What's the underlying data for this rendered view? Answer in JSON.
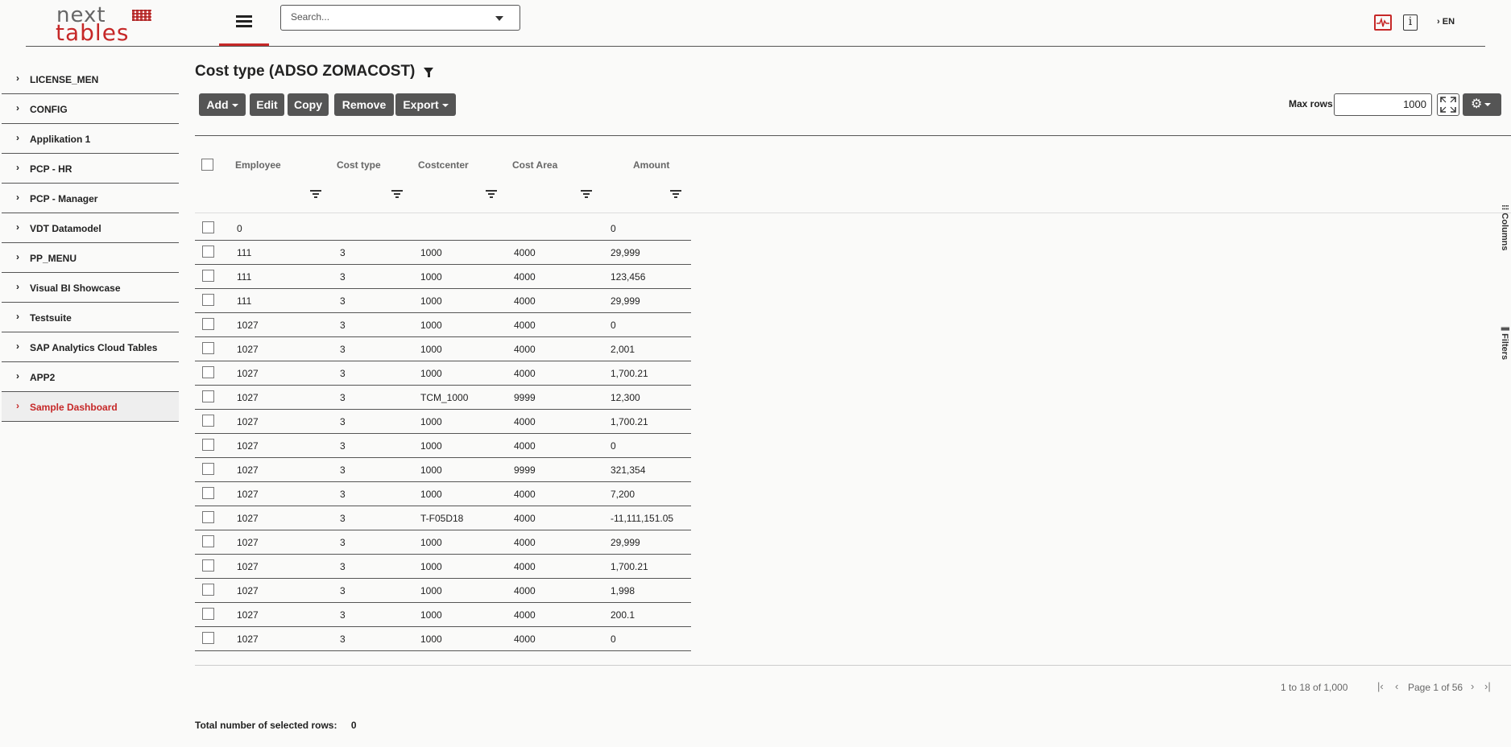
{
  "header": {
    "logo_top": "next",
    "logo_bottom": "tables",
    "search_placeholder": "Search...",
    "language": "EN",
    "info_icon_glyph": "i"
  },
  "sidebar": {
    "items": [
      {
        "label": "LICENSE_MEN"
      },
      {
        "label": "CONFIG"
      },
      {
        "label": "Applikation 1"
      },
      {
        "label": "PCP - HR"
      },
      {
        "label": "PCP - Manager"
      },
      {
        "label": "VDT Datamodel"
      },
      {
        "label": "PP_MENU"
      },
      {
        "label": "Visual BI Showcase"
      },
      {
        "label": "Testsuite"
      },
      {
        "label": "SAP Analytics Cloud Tables"
      },
      {
        "label": "APP2"
      },
      {
        "label": "Sample Dashboard",
        "active": true
      }
    ]
  },
  "main": {
    "title": "Cost type (ADSO ZOMACOST)",
    "toolbar": {
      "add": "Add",
      "edit": "Edit",
      "copy": "Copy",
      "remove": "Remove",
      "export": "Export"
    },
    "max_rows_label": "Max rows",
    "max_rows_value": "1000"
  },
  "grid": {
    "columns": [
      "Employee",
      "Cost type",
      "Costcenter",
      "Cost Area",
      "Amount"
    ],
    "rows": [
      [
        "0",
        "",
        "",
        "",
        "0"
      ],
      [
        "111",
        "3",
        "1000",
        "4000",
        "29,999"
      ],
      [
        "111",
        "3",
        "1000",
        "4000",
        "123,456"
      ],
      [
        "111",
        "3",
        "1000",
        "4000",
        "29,999"
      ],
      [
        "1027",
        "3",
        "1000",
        "4000",
        "0"
      ],
      [
        "1027",
        "3",
        "1000",
        "4000",
        "2,001"
      ],
      [
        "1027",
        "3",
        "1000",
        "4000",
        "1,700.21"
      ],
      [
        "1027",
        "3",
        "TCM_1000",
        "9999",
        "12,300"
      ],
      [
        "1027",
        "3",
        "1000",
        "4000",
        "1,700.21"
      ],
      [
        "1027",
        "3",
        "1000",
        "4000",
        "0"
      ],
      [
        "1027",
        "3",
        "1000",
        "9999",
        "321,354"
      ],
      [
        "1027",
        "3",
        "1000",
        "4000",
        "7,200"
      ],
      [
        "1027",
        "3",
        "T-F05D18",
        "4000",
        "-11,111,151.05"
      ],
      [
        "1027",
        "3",
        "1000",
        "4000",
        "29,999"
      ],
      [
        "1027",
        "3",
        "1000",
        "4000",
        "1,700.21"
      ],
      [
        "1027",
        "3",
        "1000",
        "4000",
        "1,998"
      ],
      [
        "1027",
        "3",
        "1000",
        "4000",
        "200.1"
      ],
      [
        "1027",
        "3",
        "1000",
        "4000",
        "0"
      ]
    ],
    "side_tabs": {
      "columns": "Columns",
      "filters": "Filters"
    },
    "pager": {
      "range": "1 to 18 of 1,000",
      "page": "Page 1 of 56"
    },
    "total_label": "Total number of selected rows:",
    "total_value": "0"
  },
  "colors": {
    "accent": "#c62828",
    "button_bg": "#555555"
  }
}
